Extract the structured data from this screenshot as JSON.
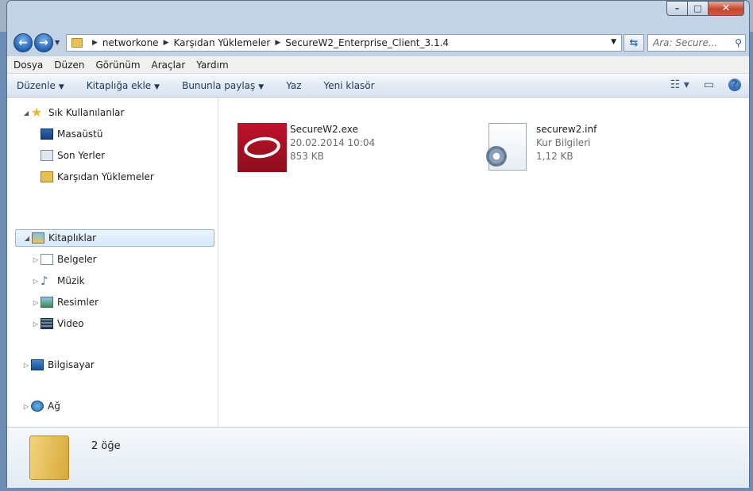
{
  "titlebar": {
    "minimize_glyph": "–",
    "maximize_glyph": "□",
    "close_glyph": "✕"
  },
  "navigation": {
    "back_glyph": "←",
    "forward_glyph": "→",
    "breadcrumb": [
      "networkone",
      "Karşıdan Yüklemeler",
      "SecureW2_Enterprise_Client_3.1.4"
    ],
    "search_placeholder": "Ara: Secure...",
    "refresh_glyph": "⇆"
  },
  "menu": [
    {
      "label": "Dosya"
    },
    {
      "label": "Düzen"
    },
    {
      "label": "Görünüm"
    },
    {
      "label": "Araçlar"
    },
    {
      "label": "Yardım"
    }
  ],
  "commands": [
    {
      "label": "Düzenle",
      "dropdown": true
    },
    {
      "label": "Kitaplığa ekle",
      "dropdown": true
    },
    {
      "label": "Bununla paylaş",
      "dropdown": true
    },
    {
      "label": "Yaz",
      "dropdown": false
    },
    {
      "label": "Yeni klasör",
      "dropdown": false
    }
  ],
  "command_icons": [
    "view-icon",
    "preview-pane-icon",
    "help-icon"
  ],
  "help_glyph": "?",
  "tree": {
    "favorites": {
      "label": "Sık Kullanılanlar",
      "items": [
        {
          "label": "Masaüstü",
          "icon": "desktop-icon"
        },
        {
          "label": "Son Yerler",
          "icon": "recent-places-icon"
        },
        {
          "label": "Karşıdan Yüklemeler",
          "icon": "downloads-folder-icon"
        }
      ]
    },
    "libraries": {
      "label": "Kitaplıklar",
      "items": [
        {
          "label": "Belgeler",
          "icon": "documents-icon"
        },
        {
          "label": "Müzik",
          "icon": "music-icon"
        },
        {
          "label": "Resimler",
          "icon": "pictures-icon"
        },
        {
          "label": "Video",
          "icon": "video-icon"
        }
      ]
    },
    "computer": {
      "label": "Bilgisayar",
      "icon": "computer-icon"
    },
    "network": {
      "label": "Ağ",
      "icon": "network-icon"
    }
  },
  "files": [
    {
      "name": "SecureW2.exe",
      "meta1": "20.02.2014 10:04",
      "meta2": "853 KB",
      "icon": "securew2-app-icon"
    },
    {
      "name": "securew2.inf",
      "meta1": "Kur Bilgileri",
      "meta2": "1,12 KB",
      "icon": "setup-info-file-icon"
    }
  ],
  "status": {
    "count": "2 öğe",
    "icon": "folder-icon"
  },
  "colors": {
    "selected_bg": "#d7e9fb",
    "selected_border": "#8fb8e4",
    "exe_brand": "#b0102a"
  }
}
